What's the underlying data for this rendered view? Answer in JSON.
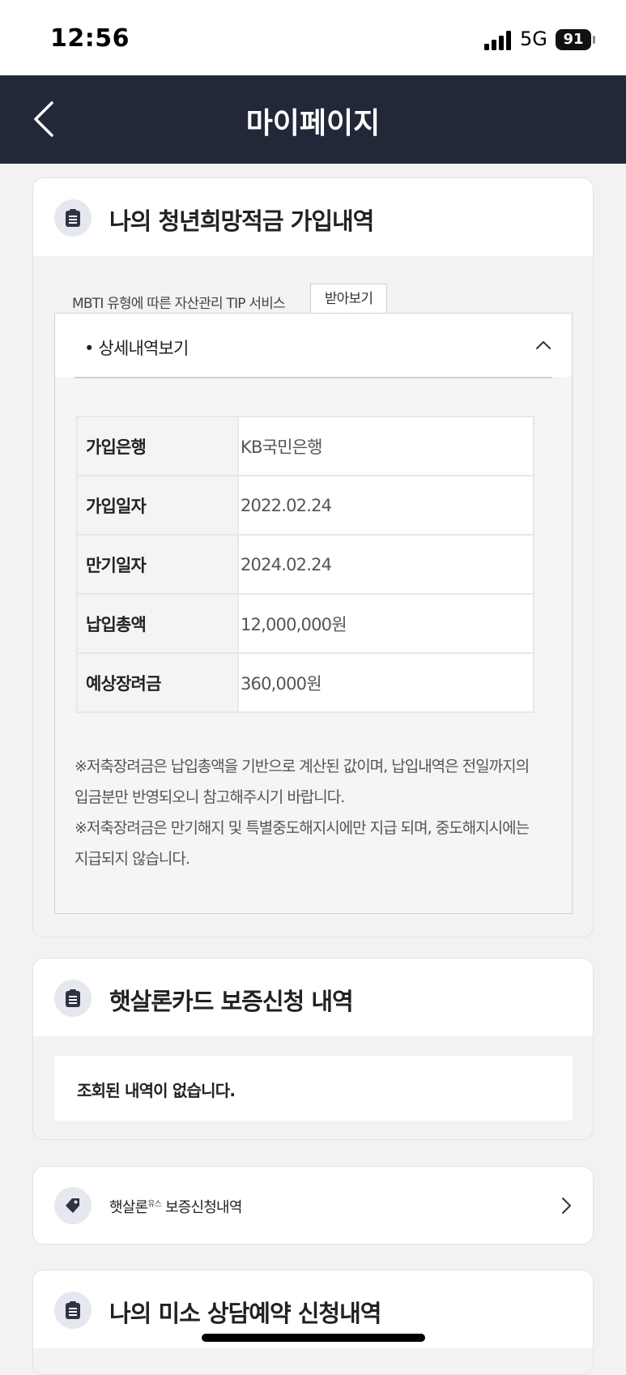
{
  "status_bar": {
    "time": "12:56",
    "network": "5G",
    "battery": "91"
  },
  "header": {
    "title": "마이페이지",
    "back_icon": "chevron-left-icon"
  },
  "savings_card": {
    "icon": "document-icon",
    "title": "나의 청년희망적금 가입내역",
    "mbti_text": "MBTI 유형에 따른 자산관리 TIP 서비스",
    "mbti_button": "받아보기",
    "detail_toggle": "• 상세내역보기",
    "rows": [
      {
        "label": "가입은행",
        "value": "KB국민은행"
      },
      {
        "label": "가입일자",
        "value": "2022.02.24"
      },
      {
        "label": "만기일자",
        "value": "2024.02.24"
      },
      {
        "label": "납입총액",
        "value": "12,000,000원"
      },
      {
        "label": "예상장려금",
        "value": "360,000원"
      }
    ],
    "notes": [
      "※저축장려금은 납입총액을 기반으로 계산된 값이며, 납입내역은 전일까지의",
      "입금분만 반영되오니 참고해주시기 바랍니다.",
      "※저축장려금은 만기해지 및 특별중도해지시에만 지급 되며, 중도해지시에는",
      "지급되지 않습니다."
    ]
  },
  "card_guarantee": {
    "icon": "document-icon",
    "title": "햇살론카드 보증신청 내역",
    "empty_text": "조회된 내역이 없습니다."
  },
  "youth_link": {
    "icon": "tag-icon",
    "label_main": "햇살론",
    "label_sup": "유스",
    "label_rest": " 보증신청내역"
  },
  "consult_card": {
    "icon": "document-icon",
    "title": "나의 미소 상담예약 신청내역"
  }
}
